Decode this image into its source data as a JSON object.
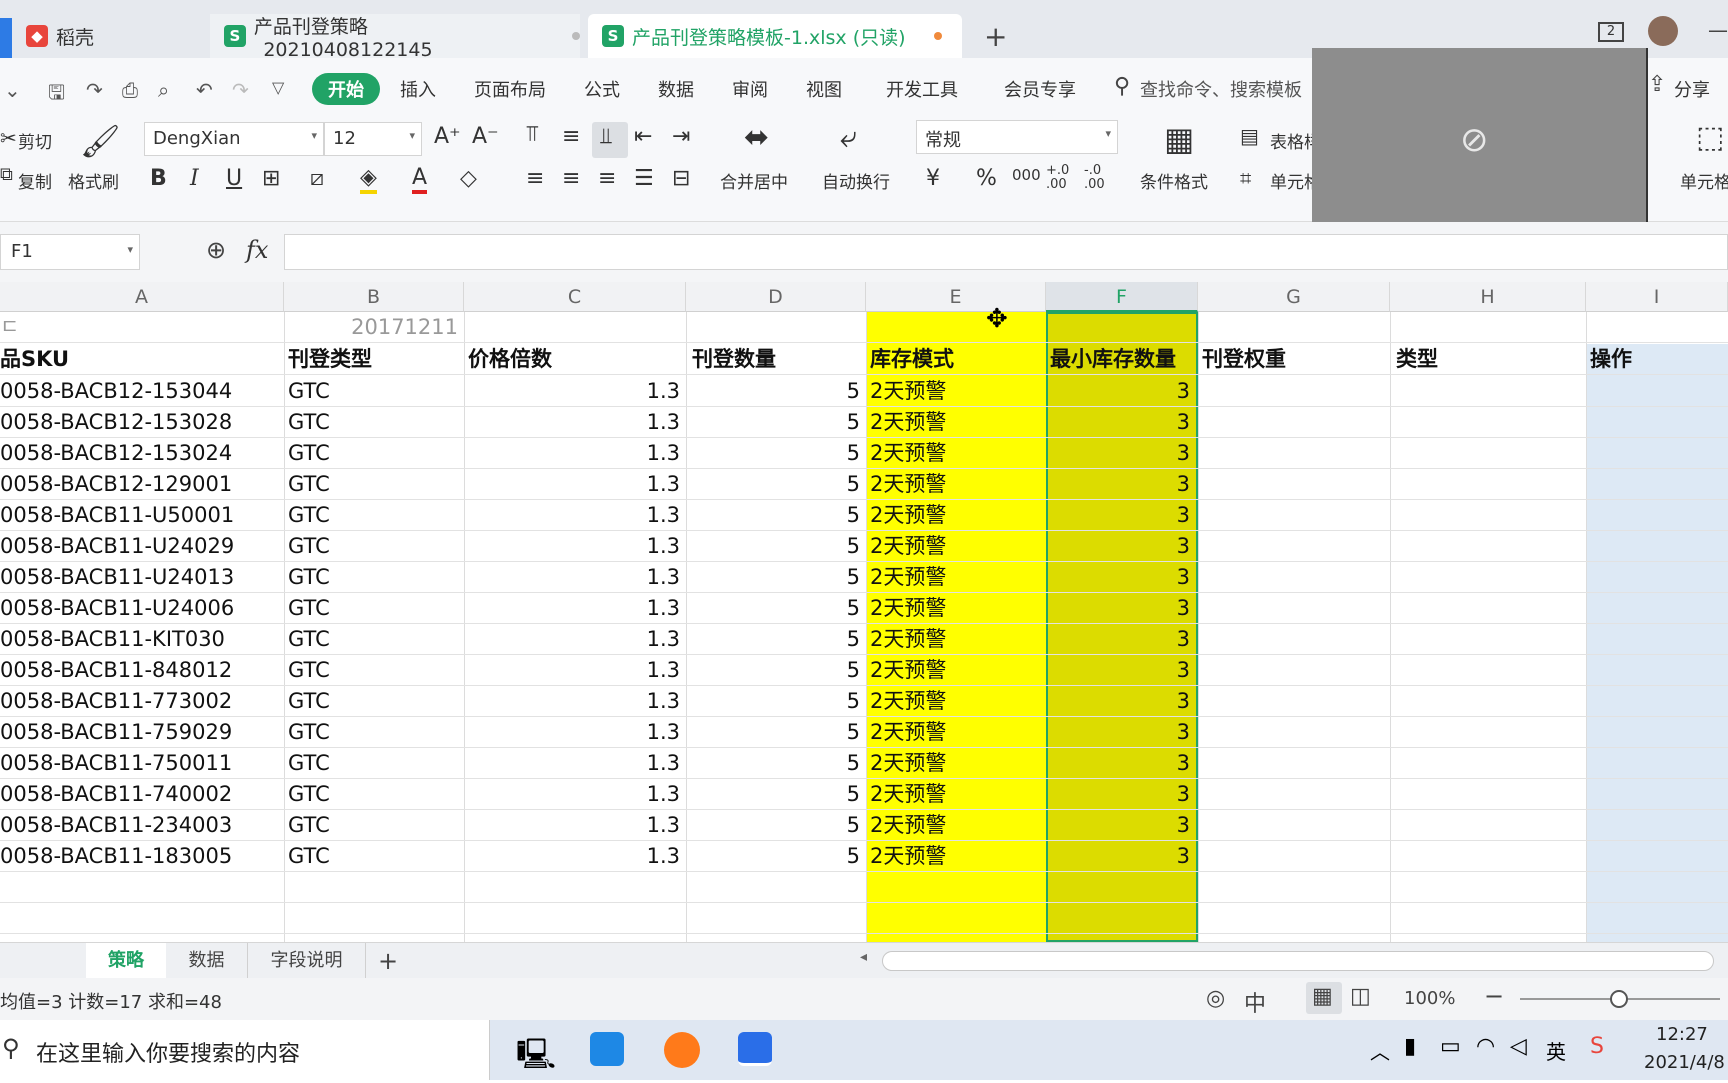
{
  "tabs": [
    {
      "label": "稻壳",
      "icon": "wps-docer-icon",
      "active": false
    },
    {
      "label": "产品刊登策略_20210408122145",
      "icon": "spreadsheet-icon",
      "active": false
    },
    {
      "label": "产品刊登策略模板-1.xlsx (只读)",
      "icon": "spreadsheet-icon",
      "active": true
    }
  ],
  "new_tab_label": "+",
  "window_badge": "2",
  "menu": {
    "items": [
      "开始",
      "插入",
      "页面布局",
      "公式",
      "数据",
      "审阅",
      "视图",
      "开发工具",
      "会员专享"
    ],
    "active": "开始",
    "search_placeholder": "查找命令、搜索模板",
    "share_label": "分享"
  },
  "ribbon": {
    "cut": "剪切",
    "copy": "复制",
    "format_painter": "格式刷",
    "font_name": "DengXian",
    "font_size": "12",
    "merge_center": "合并居中",
    "wrap_text": "自动换行",
    "number_format": "常规",
    "currency": "¥",
    "percent": "%",
    "thousands": "000",
    "inc_decimal": "+.0\n.00",
    "dec_decimal": "-.0\n.00",
    "conditional_format": "条件格式",
    "table_style": "表格样式",
    "cell_style": "单元格",
    "cell_label": "单元格"
  },
  "formula_bar": {
    "name_box": "F1",
    "fx": "fx",
    "content": ""
  },
  "columns": [
    "A",
    "B",
    "C",
    "D",
    "E",
    "F",
    "G",
    "H",
    "I"
  ],
  "selected_column": "F",
  "row0": {
    "a": "ㄷ",
    "b": "20171211"
  },
  "headers": [
    "品SKU",
    "刊登类型",
    "价格倍数",
    "刊登数量",
    "库存模式",
    "最小库存数量",
    "刊登权重",
    "类型",
    "操作"
  ],
  "rows": [
    {
      "sku": "0058-BACB12-153044",
      "type": "GTC",
      "mult": "1.3",
      "qty": "5",
      "mode": "2天预警",
      "min": "3"
    },
    {
      "sku": "0058-BACB12-153028",
      "type": "GTC",
      "mult": "1.3",
      "qty": "5",
      "mode": "2天预警",
      "min": "3"
    },
    {
      "sku": "0058-BACB12-153024",
      "type": "GTC",
      "mult": "1.3",
      "qty": "5",
      "mode": "2天预警",
      "min": "3"
    },
    {
      "sku": "0058-BACB12-129001",
      "type": "GTC",
      "mult": "1.3",
      "qty": "5",
      "mode": "2天预警",
      "min": "3"
    },
    {
      "sku": "0058-BACB11-U50001",
      "type": "GTC",
      "mult": "1.3",
      "qty": "5",
      "mode": "2天预警",
      "min": "3"
    },
    {
      "sku": "0058-BACB11-U24029",
      "type": "GTC",
      "mult": "1.3",
      "qty": "5",
      "mode": "2天预警",
      "min": "3"
    },
    {
      "sku": "0058-BACB11-U24013",
      "type": "GTC",
      "mult": "1.3",
      "qty": "5",
      "mode": "2天预警",
      "min": "3"
    },
    {
      "sku": "0058-BACB11-U24006",
      "type": "GTC",
      "mult": "1.3",
      "qty": "5",
      "mode": "2天预警",
      "min": "3"
    },
    {
      "sku": "0058-BACB11-KIT030",
      "type": "GTC",
      "mult": "1.3",
      "qty": "5",
      "mode": "2天预警",
      "min": "3"
    },
    {
      "sku": "0058-BACB11-848012",
      "type": "GTC",
      "mult": "1.3",
      "qty": "5",
      "mode": "2天预警",
      "min": "3"
    },
    {
      "sku": "0058-BACB11-773002",
      "type": "GTC",
      "mult": "1.3",
      "qty": "5",
      "mode": "2天预警",
      "min": "3"
    },
    {
      "sku": "0058-BACB11-759029",
      "type": "GTC",
      "mult": "1.3",
      "qty": "5",
      "mode": "2天预警",
      "min": "3"
    },
    {
      "sku": "0058-BACB11-750011",
      "type": "GTC",
      "mult": "1.3",
      "qty": "5",
      "mode": "2天预警",
      "min": "3"
    },
    {
      "sku": "0058-BACB11-740002",
      "type": "GTC",
      "mult": "1.3",
      "qty": "5",
      "mode": "2天预警",
      "min": "3"
    },
    {
      "sku": "0058-BACB11-234003",
      "type": "GTC",
      "mult": "1.3",
      "qty": "5",
      "mode": "2天预警",
      "min": "3"
    },
    {
      "sku": "0058-BACB11-183005",
      "type": "GTC",
      "mult": "1.3",
      "qty": "5",
      "mode": "2天预警",
      "min": "3"
    }
  ],
  "sheet_tabs": [
    "策略",
    "数据",
    "字段说明"
  ],
  "active_sheet": "策略",
  "add_sheet_label": "+",
  "status": {
    "summary": "均值=3  计数=17  求和=48",
    "zoom": "100%"
  },
  "taskbar": {
    "search_placeholder": "在这里输入你要搜索的内容",
    "ime": "英",
    "time": "12:27",
    "date": "2021/4/8"
  },
  "colors": {
    "accent": "#21a366",
    "highlight_yellow": "#ffff00",
    "highlight_selected": "#dddd00",
    "column_i_fill": "#dde9f5"
  }
}
